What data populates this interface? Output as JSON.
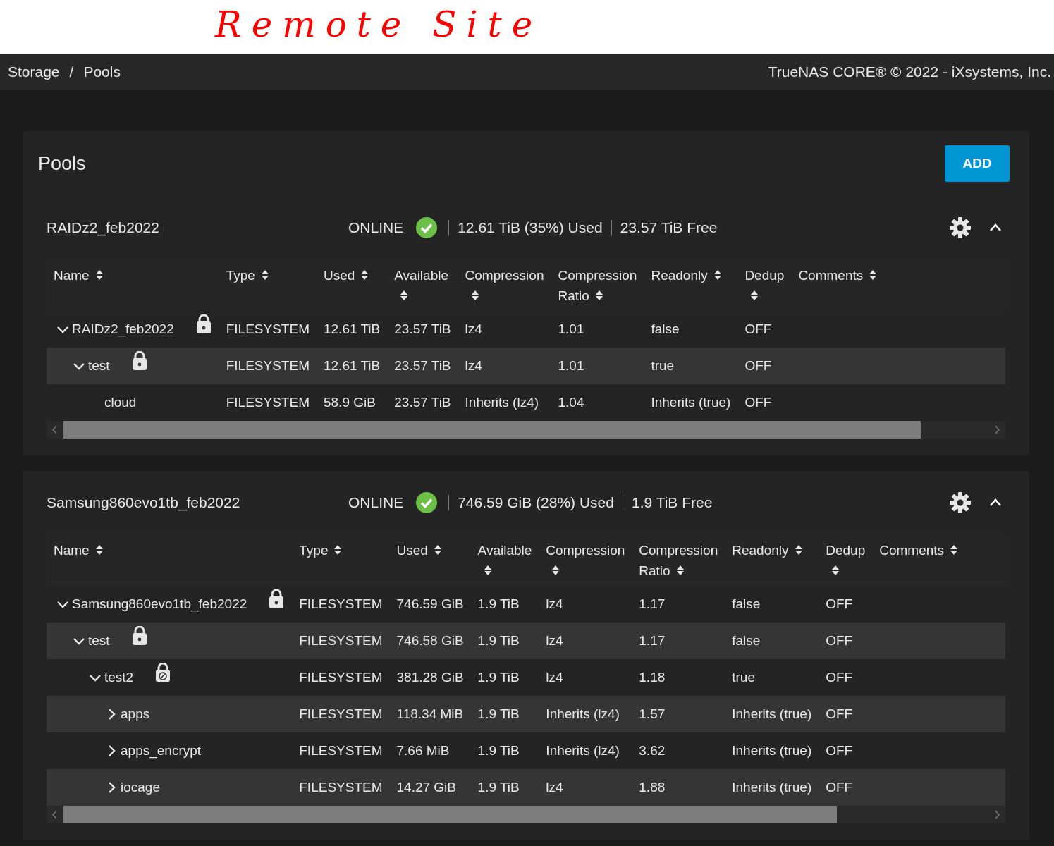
{
  "annotation": "Remote Site",
  "breadcrumb": {
    "items": [
      "Storage",
      "Pools"
    ],
    "separator": "/"
  },
  "copyright": "TrueNAS CORE® © 2022 - iXsystems, Inc.",
  "page_title": "Pools",
  "add_button": "ADD",
  "pools": [
    {
      "name": "RAIDz2_feb2022",
      "status": "ONLINE",
      "healthy": true,
      "used": "12.61 TiB (35%) Used",
      "free": "23.57 TiB Free",
      "expanded": true,
      "columns": [
        "Name",
        "Type",
        "Used",
        "Available",
        "Compression",
        "Compression Ratio",
        "Readonly",
        "Dedup",
        "Comments"
      ],
      "datasets": [
        {
          "name": "RAIDz2_feb2022",
          "lock": {
            "kind": "padlock"
          },
          "expanded": true,
          "cells": [
            "FILESYSTEM",
            "12.61 TiB",
            "23.57 TiB",
            "lz4",
            "1.01",
            "false",
            "OFF"
          ],
          "children": [
            {
              "name": "test",
              "lock": {
                "kind": "padlock"
              },
              "expanded": true,
              "cells": [
                "FILESYSTEM",
                "12.61 TiB",
                "23.57 TiB",
                "lz4",
                "1.01",
                "true",
                "OFF"
              ],
              "children": [
                {
                  "name": "cloud",
                  "cells": [
                    "FILESYSTEM",
                    "58.9 GiB",
                    "23.57 TiB",
                    "Inherits (lz4)",
                    "1.04",
                    "Inherits (true)",
                    "OFF"
                  ]
                }
              ]
            }
          ]
        }
      ]
    },
    {
      "name": "Samsung860evo1tb_feb2022",
      "status": "ONLINE",
      "healthy": true,
      "used": "746.59 GiB (28%) Used",
      "free": "1.9 TiB Free",
      "expanded": true,
      "columns": [
        "Name",
        "Type",
        "Used",
        "Available",
        "Compression",
        "Compression Ratio",
        "Readonly",
        "Dedup",
        "Comments"
      ],
      "datasets": [
        {
          "name": "Samsung860evo1tb_feb2022",
          "lock": {
            "kind": "padlock"
          },
          "expanded": true,
          "cells": [
            "FILESYSTEM",
            "746.59 GiB",
            "1.9 TiB",
            "lz4",
            "1.17",
            "false",
            "OFF"
          ],
          "children": [
            {
              "name": "test",
              "lock": {
                "kind": "padlock"
              },
              "expanded": true,
              "cells": [
                "FILESYSTEM",
                "746.58 GiB",
                "1.9 TiB",
                "lz4",
                "1.17",
                "false",
                "OFF"
              ],
              "children": [
                {
                  "name": "test2",
                  "lock": {
                    "kind": "blocked"
                  },
                  "expanded": true,
                  "cells": [
                    "FILESYSTEM",
                    "381.28 GiB",
                    "1.9 TiB",
                    "lz4",
                    "1.18",
                    "true",
                    "OFF"
                  ],
                  "children": [
                    {
                      "name": "apps",
                      "expanded": false,
                      "cells": [
                        "FILESYSTEM",
                        "118.34 MiB",
                        "1.9 TiB",
                        "Inherits (lz4)",
                        "1.57",
                        "Inherits (true)",
                        "OFF"
                      ]
                    },
                    {
                      "name": "apps_encrypt",
                      "expanded": false,
                      "cells": [
                        "FILESYSTEM",
                        "7.66 MiB",
                        "1.9 TiB",
                        "Inherits (lz4)",
                        "3.62",
                        "Inherits (true)",
                        "OFF"
                      ]
                    },
                    {
                      "name": "iocage",
                      "expanded": false,
                      "cells": [
                        "FILESYSTEM",
                        "14.27 GiB",
                        "1.9 TiB",
                        "lz4",
                        "1.88",
                        "Inherits (true)",
                        "OFF"
                      ]
                    }
                  ]
                }
              ]
            }
          ]
        }
      ]
    }
  ]
}
